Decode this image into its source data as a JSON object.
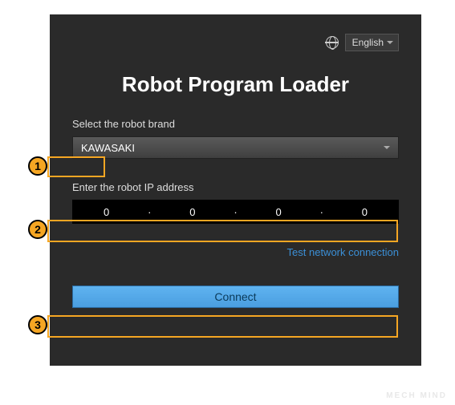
{
  "header": {
    "language": "English"
  },
  "title": "Robot Program Loader",
  "brand": {
    "label": "Select the robot brand",
    "value": "KAWASAKI"
  },
  "ip": {
    "label": "Enter the robot IP address",
    "octets": [
      "0",
      "0",
      "0",
      "0"
    ]
  },
  "test_link": "Test network connection",
  "connect": "Connect",
  "annotations": {
    "a1": "1",
    "a2": "2",
    "a3": "3"
  },
  "watermark": "MECH MIND"
}
